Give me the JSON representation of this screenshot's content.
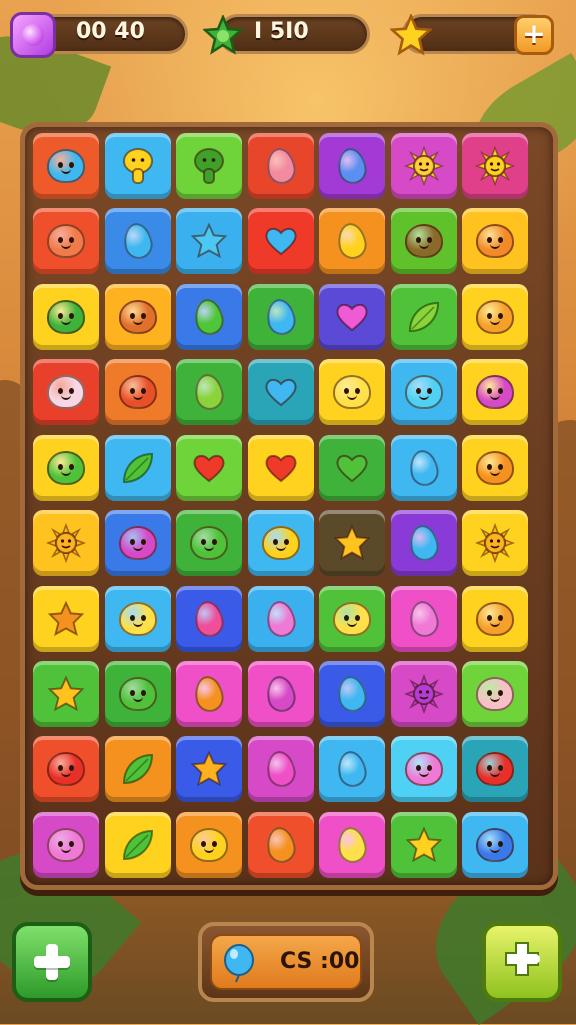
{
  "hud": {
    "gems": {
      "value": "00  40",
      "icon": "gem-icon",
      "color": "#c94ee8"
    },
    "moves": {
      "value": "I  5I0",
      "icon": "green-star-icon",
      "color": "#3fb23a"
    },
    "stars": {
      "icon": "star-icon",
      "color": "#ffd21f",
      "add_label": "+"
    }
  },
  "board": {
    "rows": 10,
    "cols": 7,
    "tiles": [
      [
        {
          "c": "#ef5a2a",
          "i": "blob",
          "g": "#3fb7f0"
        },
        {
          "c": "#3fb7f0",
          "i": "mushroom",
          "g": "#ffd21f"
        },
        {
          "c": "#6fd33a",
          "i": "mushroom",
          "g": "#3fa02a"
        },
        {
          "c": "#e8462a",
          "i": "drop",
          "g": "#f28aa0"
        },
        {
          "c": "#a33ad6",
          "i": "drop",
          "g": "#5b8ff0"
        },
        {
          "c": "#d64ac7",
          "i": "sun",
          "g": "#ffcf3a"
        },
        {
          "c": "#e0408a",
          "i": "sun",
          "g": "#ffd21f"
        }
      ],
      [
        {
          "c": "#ef4f2a",
          "i": "blob",
          "g": "#f07a4a"
        },
        {
          "c": "#3a8ae8",
          "i": "drop",
          "g": "#3fb7f0"
        },
        {
          "c": "#3ab0ef",
          "i": "star",
          "g": "#4cc8f5"
        },
        {
          "c": "#ef3a2a",
          "i": "heart",
          "g": "#3fb7f0"
        },
        {
          "c": "#f5911f",
          "i": "drop",
          "g": "#ffd21f"
        },
        {
          "c": "#5fc22a",
          "i": "blob",
          "g": "#8a6a2a"
        },
        {
          "c": "#ffc21f",
          "i": "blob",
          "g": "#f28a2a"
        }
      ],
      [
        {
          "c": "#ffd21f",
          "i": "blob",
          "g": "#3fb23a"
        },
        {
          "c": "#ffb21f",
          "i": "blob",
          "g": "#e0702a"
        },
        {
          "c": "#3a7ae8",
          "i": "drop",
          "g": "#4fc63a"
        },
        {
          "c": "#3fb23a",
          "i": "drop",
          "g": "#3fb7f0"
        },
        {
          "c": "#5a4ad6",
          "i": "heart",
          "g": "#ef5ad6"
        },
        {
          "c": "#4fc23a",
          "i": "leaf",
          "g": "#8ad33a"
        },
        {
          "c": "#ffd21f",
          "i": "blob",
          "g": "#f5a02a"
        }
      ],
      [
        {
          "c": "#e8402a",
          "i": "blob",
          "g": "#f7d7e6"
        },
        {
          "c": "#ef7a2a",
          "i": "blob",
          "g": "#e8502a"
        },
        {
          "c": "#3fb23a",
          "i": "drop",
          "g": "#8ad33a"
        },
        {
          "c": "#2aa5b8",
          "i": "heart",
          "g": "#3fb7f0"
        },
        {
          "c": "#ffd21f",
          "i": "blob",
          "g": "#ffe04a"
        },
        {
          "c": "#3fb7f0",
          "i": "blob",
          "g": "#4fd0f5"
        },
        {
          "c": "#ffd21f",
          "i": "blob",
          "g": "#d64ac7"
        }
      ],
      [
        {
          "c": "#ffd21f",
          "i": "blob",
          "g": "#4fc23a"
        },
        {
          "c": "#3fb7f0",
          "i": "leaf",
          "g": "#4fc23a"
        },
        {
          "c": "#6fd33a",
          "i": "heart",
          "g": "#ef3a2a"
        },
        {
          "c": "#ffd21f",
          "i": "heart",
          "g": "#ef3a2a"
        },
        {
          "c": "#3fb23a",
          "i": "heart",
          "g": "#4fc23a"
        },
        {
          "c": "#3fb7f0",
          "i": "drop",
          "g": "#3fb7f0"
        },
        {
          "c": "#ffd21f",
          "i": "blob",
          "g": "#f5911f"
        }
      ],
      [
        {
          "c": "#ffc21f",
          "i": "sun",
          "g": "#ffb21f"
        },
        {
          "c": "#3a7ae8",
          "i": "blob",
          "g": "#d64ac7"
        },
        {
          "c": "#3fb23a",
          "i": "blob",
          "g": "#4fc23a"
        },
        {
          "c": "#3fb7f0",
          "i": "blob",
          "g": "#ffd21f"
        },
        {
          "c": "#5a4a2a",
          "i": "star",
          "g": "#ffc21f"
        },
        {
          "c": "#8a3ad6",
          "i": "drop",
          "g": "#3fb7f0"
        },
        {
          "c": "#ffd21f",
          "i": "sun",
          "g": "#ffb21f"
        }
      ],
      [
        {
          "c": "#ffd21f",
          "i": "star",
          "g": "#f5911f"
        },
        {
          "c": "#3fb7f0",
          "i": "blob",
          "g": "#ffe04a"
        },
        {
          "c": "#3a5ae8",
          "i": "drop",
          "g": "#ef4f9a"
        },
        {
          "c": "#3ab0ef",
          "i": "drop",
          "g": "#ef7ad6"
        },
        {
          "c": "#4fc23a",
          "i": "blob",
          "g": "#ffe04a"
        },
        {
          "c": "#ef4fc7",
          "i": "drop",
          "g": "#ef7ad6"
        },
        {
          "c": "#ffd21f",
          "i": "blob",
          "g": "#f5a02a"
        }
      ],
      [
        {
          "c": "#4fc23a",
          "i": "star",
          "g": "#ffc21f"
        },
        {
          "c": "#3fb23a",
          "i": "blob",
          "g": "#4fc23a"
        },
        {
          "c": "#ef4fc7",
          "i": "drop",
          "g": "#f5911f"
        },
        {
          "c": "#ef4fc7",
          "i": "drop",
          "g": "#d64ac7"
        },
        {
          "c": "#3a5ae8",
          "i": "drop",
          "g": "#3fb7f0"
        },
        {
          "c": "#d64ac7",
          "i": "sun",
          "g": "#b83ad6"
        },
        {
          "c": "#6fd33a",
          "i": "blob",
          "g": "#f7c0c8"
        }
      ],
      [
        {
          "c": "#ef4f2a",
          "i": "blob",
          "g": "#e8302a"
        },
        {
          "c": "#f5911f",
          "i": "leaf",
          "g": "#4fc23a"
        },
        {
          "c": "#3a5ae8",
          "i": "star",
          "g": "#ffb21f"
        },
        {
          "c": "#d64ac7",
          "i": "drop",
          "g": "#ef4fc7"
        },
        {
          "c": "#3fb7f0",
          "i": "drop",
          "g": "#3fb7f0"
        },
        {
          "c": "#4fd0f5",
          "i": "blob",
          "g": "#ef7ad6"
        },
        {
          "c": "#2aa5b8",
          "i": "blob",
          "g": "#e8302a"
        }
      ],
      [
        {
          "c": "#d64ac7",
          "i": "blob",
          "g": "#ef7ad6"
        },
        {
          "c": "#ffd21f",
          "i": "leaf",
          "g": "#4fc23a"
        },
        {
          "c": "#f5911f",
          "i": "blob",
          "g": "#ffd21f"
        },
        {
          "c": "#ef4f2a",
          "i": "drop",
          "g": "#f5911f"
        },
        {
          "c": "#ef4fc7",
          "i": "drop",
          "g": "#ffe04a"
        },
        {
          "c": "#4fc23a",
          "i": "star",
          "g": "#ffd21f"
        },
        {
          "c": "#3fb7f0",
          "i": "blob",
          "g": "#3a7ae8"
        }
      ]
    ]
  },
  "bottom": {
    "left_button": {
      "icon": "plus-icon",
      "color": "#3fb23a"
    },
    "coins": {
      "value": "CS :00",
      "icon": "balloon-icon",
      "color": "#3fb7f0"
    },
    "right_button": {
      "icon": "puzzle-plus-icon",
      "color": "#a6d32a"
    }
  }
}
